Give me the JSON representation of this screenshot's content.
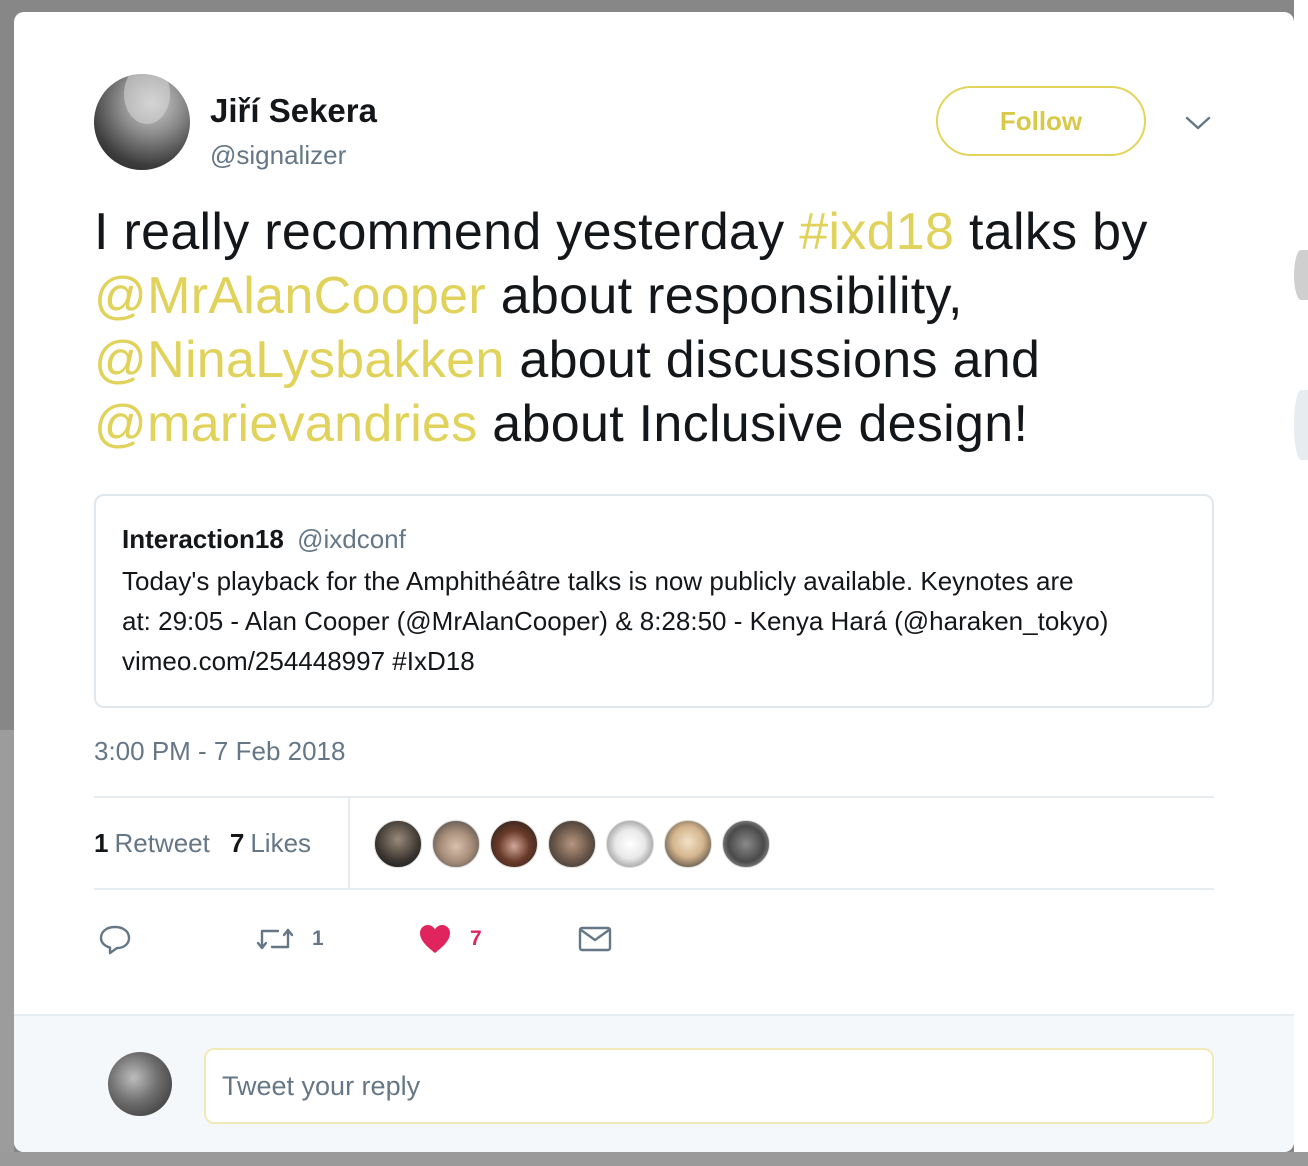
{
  "tweet": {
    "author": {
      "display_name": "Jiří Sekera",
      "screen_name": "@signalizer"
    },
    "follow_label": "Follow",
    "text": {
      "line1_a": "I really recommend yesterday ",
      "line1_tag": "#ixd18",
      "line1_b": " talks by",
      "line2_mention": "@MrAlanCooper",
      "line2_b": " about responsibility,",
      "line3_mention": "@NinaLysbakken",
      "line3_b": " about discussions and",
      "line4_mention": "@marievandries",
      "line4_b": " about Inclusive design!"
    },
    "quoted": {
      "name": "Interaction18",
      "handle": "@ixdconf",
      "line1": "Today's playback for the Amphithéâtre talks is now publicly available. Keynotes are",
      "line2": "at: 29:05 - Alan Cooper (@MrAlanCooper) &  8:28:50 - Kenya Hará (@haraken_tokyo)",
      "line3": "vimeo.com/254448997 #IxD18"
    },
    "timestamp": "3:00 PM - 7 Feb 2018",
    "stats": {
      "retweets_count": "1",
      "retweets_label": "Retweet",
      "likes_count": "7",
      "likes_label": "Likes"
    },
    "actions": {
      "reply_icon": "reply-icon",
      "retweet_icon": "retweet-icon",
      "retweet_count": "1",
      "like_icon": "heart-icon",
      "like_count": "7",
      "dm_icon": "envelope-icon"
    }
  },
  "reply": {
    "placeholder": "Tweet your reply"
  },
  "colors": {
    "accent": "#e0d25a",
    "like": "#e0245e",
    "text": "#14171a",
    "muted": "#657786"
  }
}
